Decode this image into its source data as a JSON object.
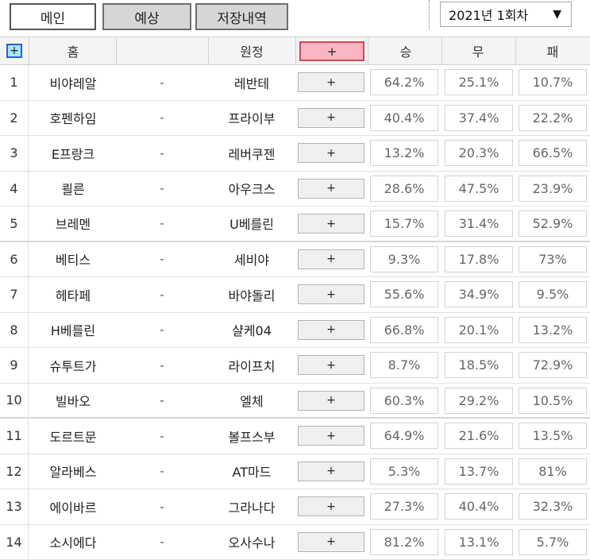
{
  "tabs": [
    {
      "label": "메인"
    },
    {
      "label": "예상"
    },
    {
      "label": "저장내역"
    }
  ],
  "round_select": {
    "value": "2021년 1회차",
    "arrow": "▼"
  },
  "header": {
    "add_all": "+",
    "home": "홈",
    "away": "원정",
    "add": "+",
    "win": "승",
    "draw": "무",
    "lose": "패"
  },
  "matches": [
    {
      "no": "1",
      "home": "비야레알",
      "sep": "-",
      "away": "레반테",
      "add": "+",
      "win": "64.2%",
      "draw": "25.1%",
      "lose": "10.7%"
    },
    {
      "no": "2",
      "home": "호펜하임",
      "sep": "-",
      "away": "프라이부",
      "add": "+",
      "win": "40.4%",
      "draw": "37.4%",
      "lose": "22.2%"
    },
    {
      "no": "3",
      "home": "E프랑크",
      "sep": "-",
      "away": "레버쿠젠",
      "add": "+",
      "win": "13.2%",
      "draw": "20.3%",
      "lose": "66.5%"
    },
    {
      "no": "4",
      "home": "쾰른",
      "sep": "-",
      "away": "아우크스",
      "add": "+",
      "win": "28.6%",
      "draw": "47.5%",
      "lose": "23.9%"
    },
    {
      "no": "5",
      "home": "브레멘",
      "sep": "-",
      "away": "U베를린",
      "add": "+",
      "win": "15.7%",
      "draw": "31.4%",
      "lose": "52.9%"
    },
    {
      "no": "6",
      "home": "베티스",
      "sep": "-",
      "away": "세비야",
      "add": "+",
      "win": "9.3%",
      "draw": "17.8%",
      "lose": "73%"
    },
    {
      "no": "7",
      "home": "헤타페",
      "sep": "-",
      "away": "바야돌리",
      "add": "+",
      "win": "55.6%",
      "draw": "34.9%",
      "lose": "9.5%"
    },
    {
      "no": "8",
      "home": "H베를린",
      "sep": "-",
      "away": "샬케04",
      "add": "+",
      "win": "66.8%",
      "draw": "20.1%",
      "lose": "13.2%"
    },
    {
      "no": "9",
      "home": "슈투트가",
      "sep": "-",
      "away": "라이프치",
      "add": "+",
      "win": "8.7%",
      "draw": "18.5%",
      "lose": "72.9%"
    },
    {
      "no": "10",
      "home": "빌바오",
      "sep": "-",
      "away": "엘체",
      "add": "+",
      "win": "60.3%",
      "draw": "29.2%",
      "lose": "10.5%"
    },
    {
      "no": "11",
      "home": "도르트문",
      "sep": "-",
      "away": "볼프스부",
      "add": "+",
      "win": "64.9%",
      "draw": "21.6%",
      "lose": "13.5%"
    },
    {
      "no": "12",
      "home": "알라베스",
      "sep": "-",
      "away": "AT마드",
      "add": "+",
      "win": "5.3%",
      "draw": "13.7%",
      "lose": "81%"
    },
    {
      "no": "13",
      "home": "에이바르",
      "sep": "-",
      "away": "그라나다",
      "add": "+",
      "win": "27.3%",
      "draw": "40.4%",
      "lose": "32.3%"
    },
    {
      "no": "14",
      "home": "소시에다",
      "sep": "-",
      "away": "오사수나",
      "add": "+",
      "win": "81.2%",
      "draw": "13.1%",
      "lose": "5.7%"
    }
  ],
  "colors": {
    "header_add_highlight": "#f7b6c1",
    "header_add_border": "#d64552",
    "select_all_fill": "#a9e6f3",
    "select_all_border": "#2a5fd8"
  }
}
